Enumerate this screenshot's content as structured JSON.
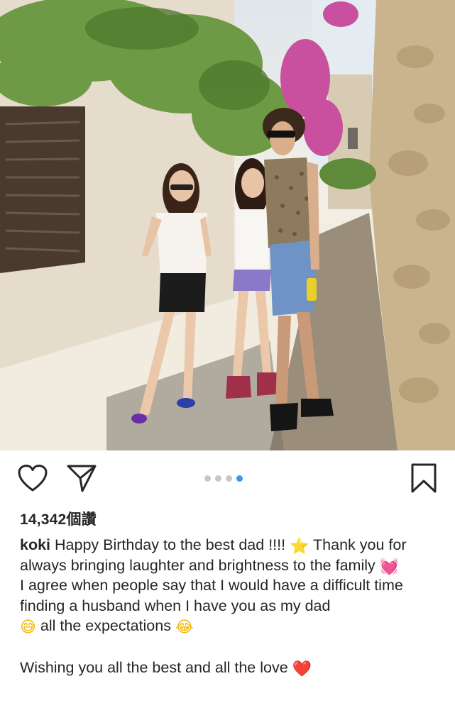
{
  "post": {
    "likes_count": "14,342",
    "likes_suffix": "個讚",
    "carousel": {
      "total": 4,
      "active_index": 3
    },
    "caption": {
      "username": "koki",
      "line1_text": " Happy Birthday to the best dad !!!! ",
      "line1_emoji": "⭐",
      "line1_after": " Thank you for always bringing laughter and brightness to the family ",
      "line1_end_emoji": "💓",
      "para2_text": "I agree when people say that I would have a difficult time finding a husband when I have you as my dad",
      "para2_emoji1": "😅",
      "para2_after": " all the expectations ",
      "para2_emoji2": "😂",
      "para3_text": "Wishing you all the best and all the love ",
      "para3_emoji": "❤️"
    }
  },
  "icons": {
    "like": "heart-outline-icon",
    "share": "paper-plane-icon",
    "save": "bookmark-outline-icon"
  },
  "colors": {
    "text": "#262626",
    "active_dot": "#3897f0",
    "inactive_dot": "#c7c7c7"
  }
}
